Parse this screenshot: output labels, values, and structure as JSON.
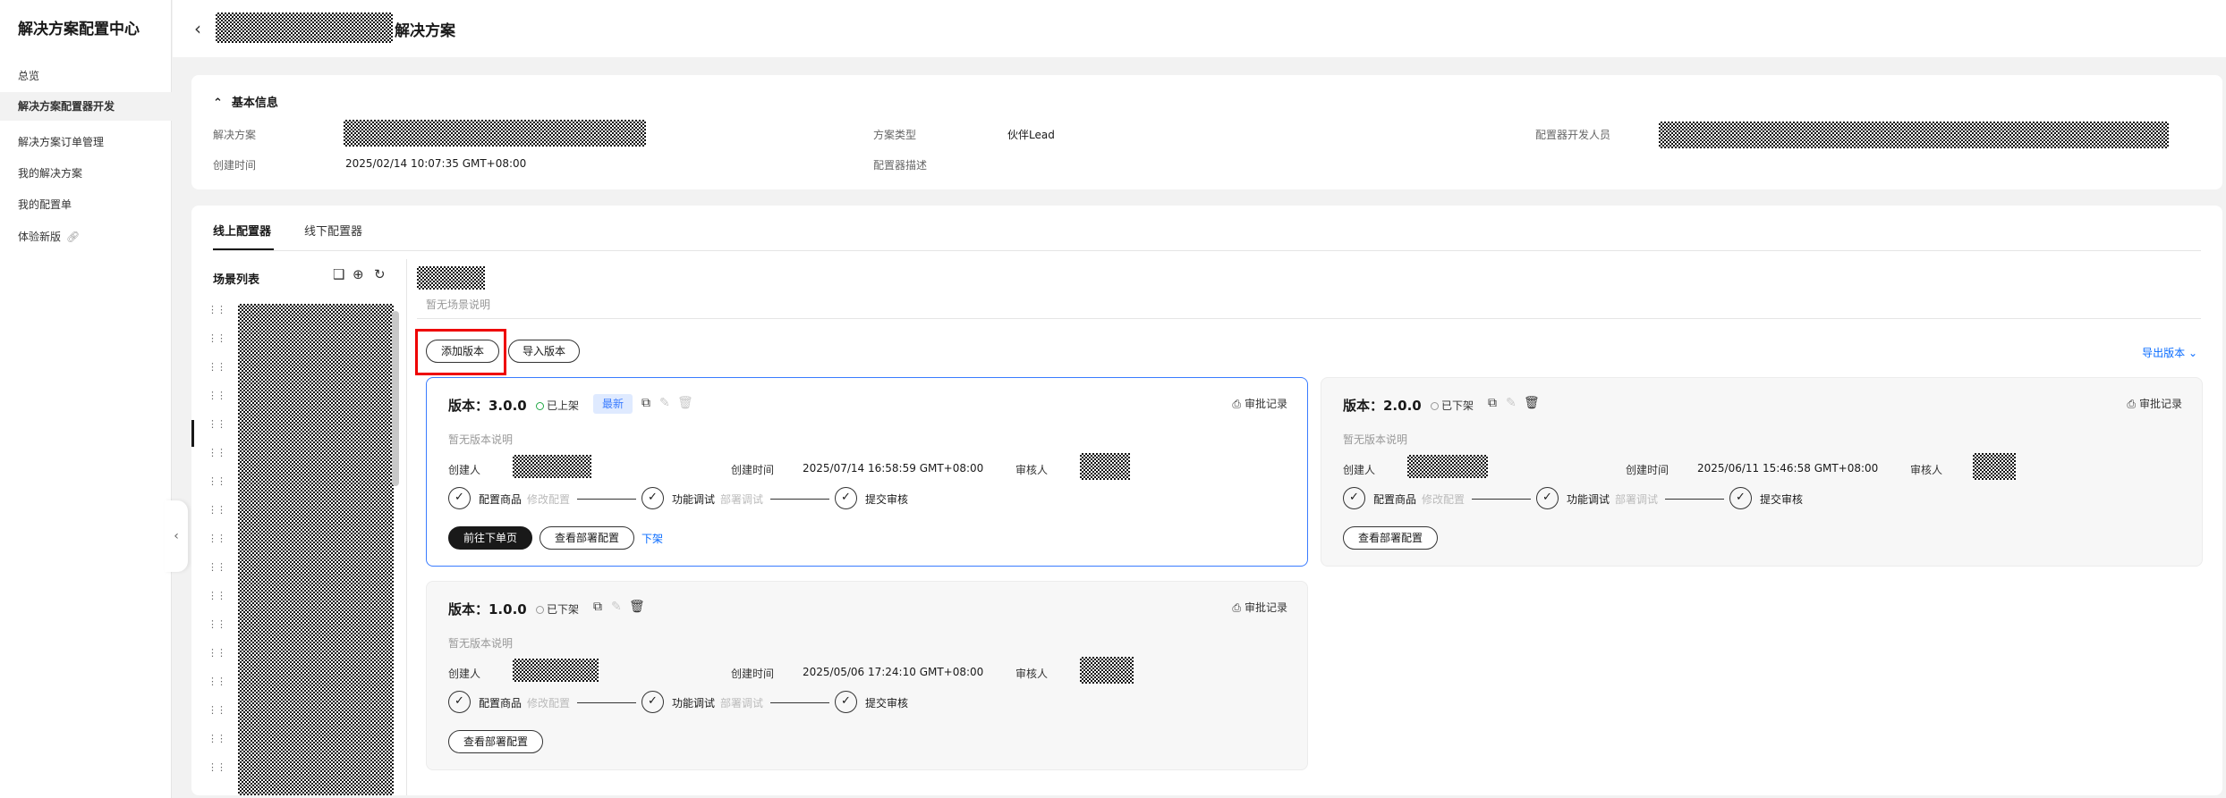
{
  "sidebar": {
    "title": "解决方案配置中心",
    "items": [
      {
        "label": "总览"
      },
      {
        "label": "解决方案配置器开发"
      },
      {
        "label": "解决方案订单管理"
      },
      {
        "label": "我的解决方案"
      },
      {
        "label": "我的配置单"
      },
      {
        "label": "体验新版"
      }
    ]
  },
  "header": {
    "title": "解决方案"
  },
  "basic": {
    "title": "基本信息",
    "solution_label": "解决方案",
    "created_label": "创建时间",
    "created_value": "2025/02/14 10:07:35 GMT+08:00",
    "type_label": "方案类型",
    "type_value": "伙伴Lead",
    "desc_label": "配置器描述",
    "dev_label": "配置器开发人员"
  },
  "tabs": [
    {
      "label": "线上配置器"
    },
    {
      "label": "线下配置器"
    }
  ],
  "scenes": {
    "title": "场景列表",
    "desc": "暂无场景说明"
  },
  "actions": {
    "add_version": "添加版本",
    "import_version": "导入版本",
    "export_version": "导出版本"
  },
  "common": {
    "creator_label": "创建人",
    "created_label": "创建时间",
    "reviewer_label": "审核人",
    "audit_label": "审批记录",
    "no_desc": "暂无版本说明",
    "steps": [
      "配置商品",
      "功能调试",
      "提交审核"
    ],
    "step_subs": [
      "修改配置",
      "部署调试"
    ],
    "view_deploy": "查看部署配置"
  },
  "versions": [
    {
      "title": "版本：3.0.0",
      "status": "已上架",
      "badge": "最新",
      "created": "2025/07/14 16:58:59 GMT+08:00",
      "go_order": "前往下单页",
      "unlist": "下架"
    },
    {
      "title": "版本：2.0.0",
      "status": "已下架",
      "created": "2025/06/11 15:46:58 GMT+08:00"
    },
    {
      "title": "版本：1.0.0",
      "status": "已下架",
      "created": "2025/05/06 17:24:10 GMT+08:00"
    }
  ],
  "colors": {
    "accent": "#3a7cff",
    "link": "#0a6cff",
    "online": "#22a845",
    "highlight": "#e00000"
  },
  "icons": [
    "chevron-left-icon",
    "chevron-up-icon",
    "link-icon",
    "drag-handle-icon",
    "copy-icon",
    "edit-icon",
    "delete-icon",
    "audit-icon",
    "check-circle-icon",
    "chevron-down-icon",
    "new-scene-icon",
    "add-icon",
    "refresh-icon"
  ]
}
